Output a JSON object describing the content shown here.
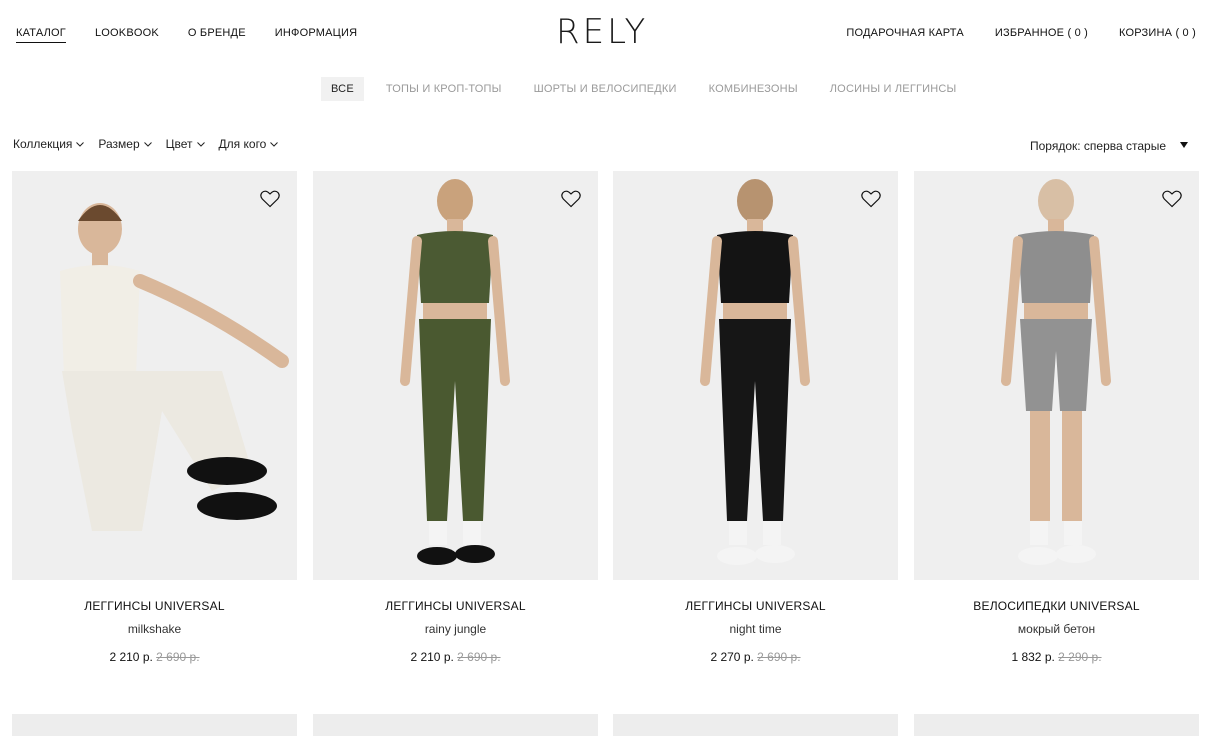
{
  "header": {
    "nav_left": [
      "КАТАЛОГ",
      "LOOKBOOK",
      "О БРЕНДЕ",
      "ИНФОРМАЦИЯ"
    ],
    "logo": "RELY",
    "nav_right": [
      "ПОДАРОЧНАЯ КАРТА",
      "ИЗБРАННОЕ ( 0 )",
      "КОРЗИНА ( 0 )"
    ]
  },
  "tabs": [
    "ВСЕ",
    "ТОПЫ И КРОП-ТОПЫ",
    "ШОРТЫ И ВЕЛОСИПЕДКИ",
    "КОМБИНЕЗОНЫ",
    "ЛОСИНЫ И ЛЕГГИНСЫ"
  ],
  "filters": [
    "Коллекция",
    "Размер",
    "Цвет",
    "Для кого"
  ],
  "sort": {
    "label": "Порядок: сперва старые"
  },
  "products": [
    {
      "name": "ЛЕГГИНСЫ UNIVERSAL",
      "color": "milkshake",
      "price": "2 210 р.",
      "old_price": "2 690 р.",
      "top_color": "#f1eee6",
      "bottom_color": "#ece9e1",
      "shoe_color": "#111111"
    },
    {
      "name": "ЛЕГГИНСЫ UNIVERSAL",
      "color": "rainy jungle",
      "price": "2 210 р.",
      "old_price": "2 690 р.",
      "top_color": "#4b5a33",
      "bottom_color": "#4a5930",
      "shoe_color": "#111111"
    },
    {
      "name": "ЛЕГГИНСЫ UNIVERSAL",
      "color": "night time",
      "price": "2 270 р.",
      "old_price": "2 690 р.",
      "top_color": "#141414",
      "bottom_color": "#161616",
      "shoe_color": "#f4f4f4"
    },
    {
      "name": "ВЕЛОСИПЕДКИ UNIVERSAL",
      "color": "мокрый бетон",
      "price": "1 832 р.",
      "old_price": "2 290 р.",
      "top_color": "#8e8e8e",
      "bottom_color": "#929292",
      "shoe_color": "#f4f4f4"
    }
  ]
}
